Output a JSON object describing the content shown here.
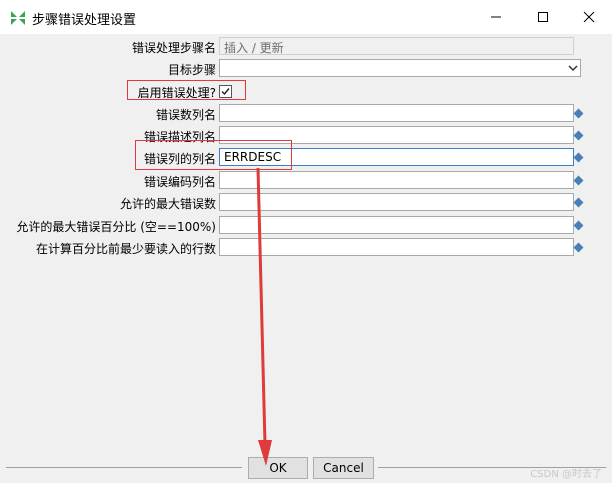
{
  "window": {
    "title": "步骤错误处理设置",
    "icon": "kettle-spoon-icon",
    "controls": [
      "minimize-icon",
      "maximize-icon",
      "close-icon"
    ]
  },
  "form": {
    "source_step": {
      "label": "错误处理步骤名",
      "value": "插入 / 更新"
    },
    "target_step": {
      "label": "目标步骤",
      "value": ""
    },
    "enable_error_handling": {
      "label": "启用错误处理?",
      "checked": true
    },
    "error_count_field": {
      "label": "错误数列名",
      "value": ""
    },
    "error_desc_field": {
      "label": "错误描述列名",
      "value": ""
    },
    "error_field_name": {
      "label": "错误列的列名",
      "value": "ERRDESC"
    },
    "error_code_field": {
      "label": "错误编码列名",
      "value": ""
    },
    "max_errors": {
      "label": "允许的最大错误数",
      "value": ""
    },
    "max_error_percent": {
      "label": "允许的最大错误百分比 (空==100%)",
      "value": ""
    },
    "min_rows_before_percent": {
      "label": "在计算百分比前最少要读入的行数",
      "value": ""
    }
  },
  "buttons": {
    "ok": "OK",
    "cancel": "Cancel"
  },
  "watermark": "CSDN @时去了",
  "colors": {
    "highlight": "#e03a3a",
    "variable_icon": "#4a7fb5"
  }
}
